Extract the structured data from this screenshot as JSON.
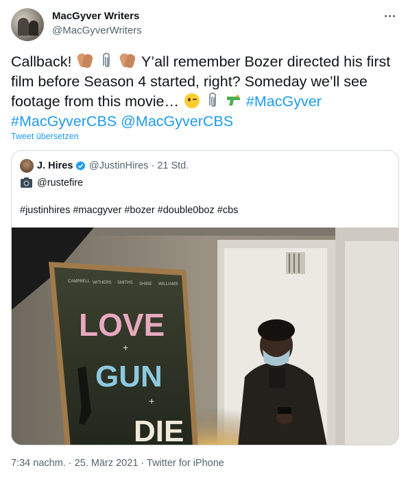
{
  "author": {
    "name": "MacGyver Writers",
    "handle": "@MacGyverWriters"
  },
  "tweet": {
    "t1": "Callback! ",
    "t2": " Y’all remember Bozer directed his first film before Season 4 started, right? Someday we’ll see footage from this movie… ",
    "hashtag1": "#MacGyver",
    "hashtag2": "#MacGyverCBS",
    "mention": "@MacGyverCBS",
    "emoji_icons": [
      "clapping-hands-icon",
      "paperclip-icon",
      "clapping-hands-icon",
      "winking-face-icon",
      "paperclip-icon",
      "water-pistol-icon"
    ]
  },
  "translate_label": "Tweet übersetzen",
  "quoted": {
    "name": "J. Hires",
    "handle_time": "@JustinHires · 21 Std.",
    "mention": "@rustefire",
    "hashtags": "#justinhires #macgyver #bozer #double0boz #cbs",
    "poster": {
      "line1": "LOVE",
      "line2": "GUN",
      "line3": "DIE",
      "small": "+",
      "credits": [
        "CAMPBELL",
        "WITHERS",
        "SMITHS",
        "SHIRE",
        "WILLIAMS"
      ]
    }
  },
  "footer": {
    "time_date": "7:34 nachm. · 25. März 2021 · ",
    "source": "Twitter for iPhone"
  },
  "colors": {
    "link": "#1d9bf0",
    "text": "#0f1419",
    "muted": "#536471",
    "border": "#cfd9de",
    "poster_pink": "#e8a9c0",
    "poster_blue": "#8ec9e0"
  }
}
